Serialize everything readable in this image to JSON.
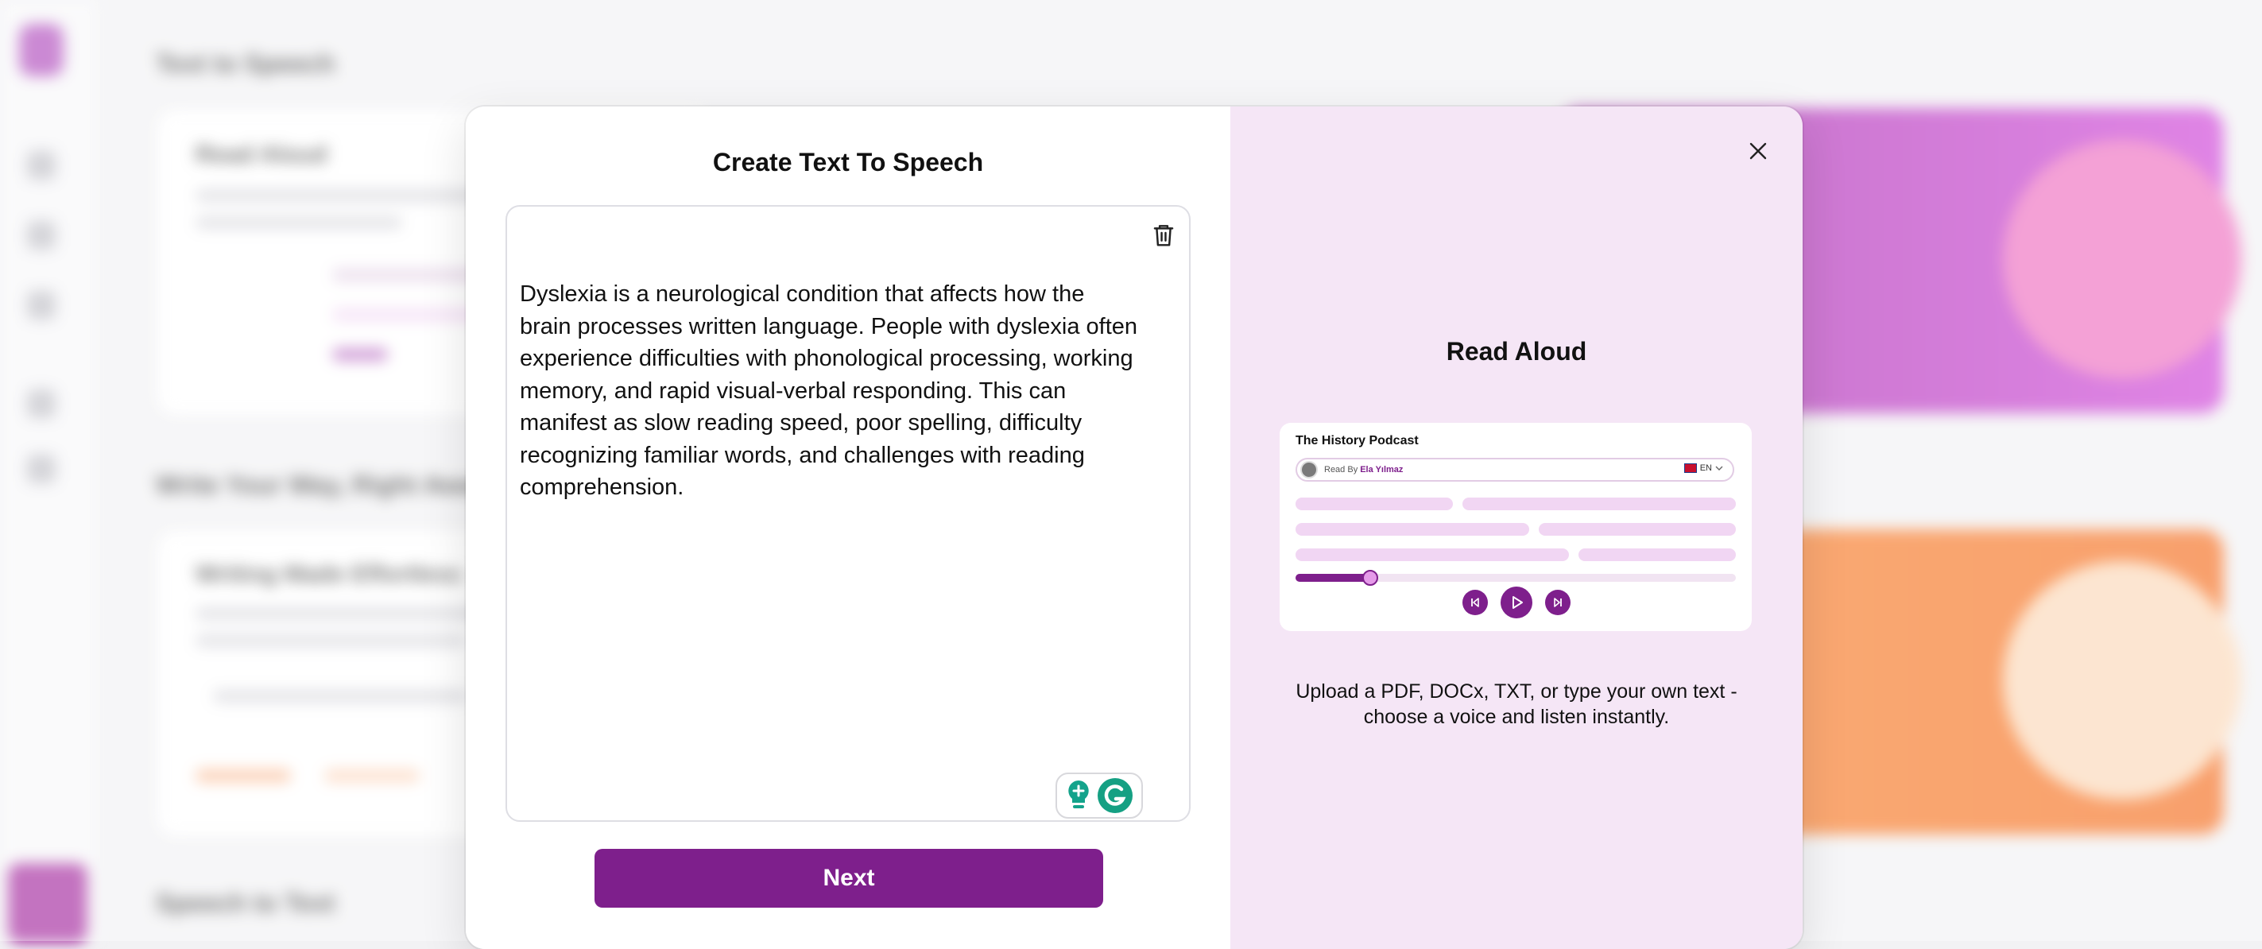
{
  "background": {
    "headings": [
      "Text to Speech",
      "Write Your Way, Right Away",
      "Speech to Text"
    ],
    "card_titles": [
      "Read Aloud",
      "Writing Made Effortless"
    ]
  },
  "modal": {
    "title": "Create Text To Speech",
    "text_content": "Dyslexia is a neurological condition that affects how the brain processes written language. People with dyslexia often experience difficulties with phonological processing, working memory, and rapid visual-verbal responding. This can manifest as slow reading speed, poor spelling, difficulty recognizing familiar words, and challenges with reading comprehension.",
    "next_label": "Next",
    "trash_icon": "trash-icon",
    "close_icon": "close-icon"
  },
  "read_aloud": {
    "title": "Read Aloud",
    "preview": {
      "podcast_title": "The History Podcast",
      "read_by_label": "Read By",
      "reader_name": "Ela Yılmaz",
      "language": "EN",
      "progress": 0.17
    },
    "description": "Upload a PDF, DOCx, TXT, or type your own text - choose a voice and listen instantly."
  },
  "colors": {
    "accent": "#7e1f8c",
    "right_panel_bg": "#f5e6f6",
    "preview_bar": "#f1d6f3"
  }
}
